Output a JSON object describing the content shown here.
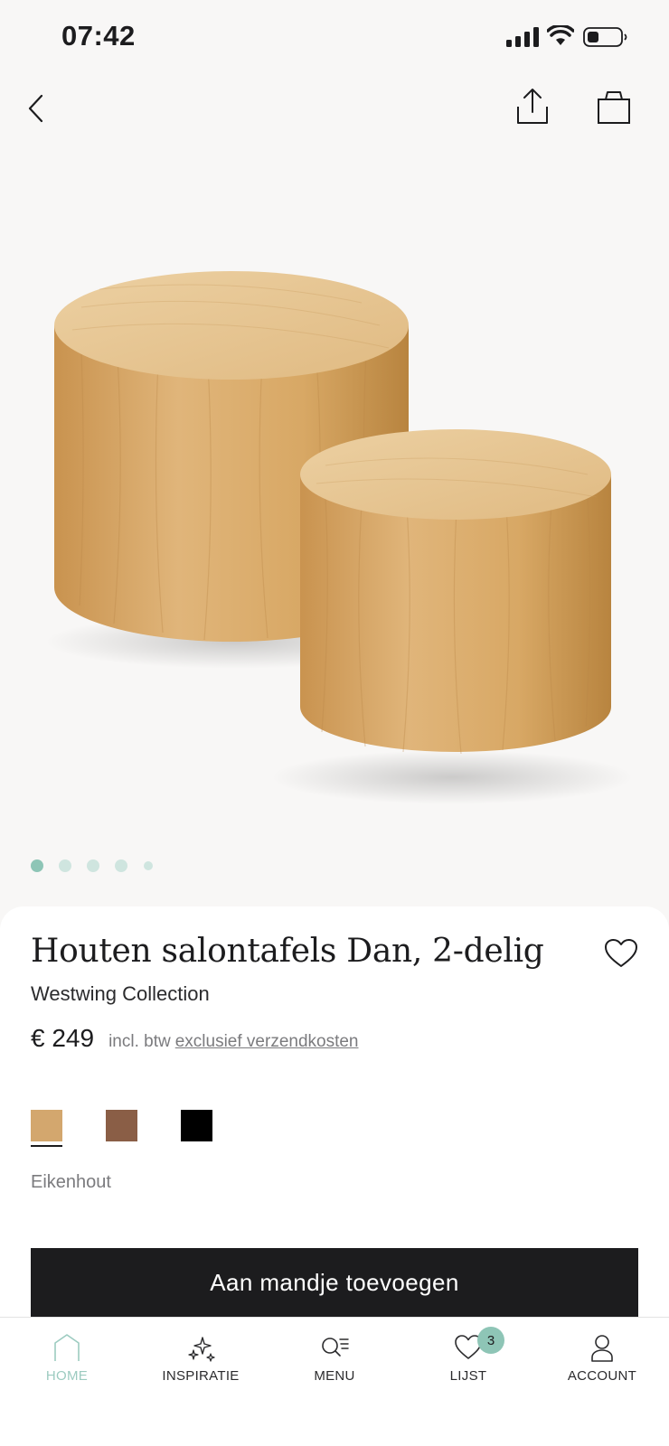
{
  "status_bar": {
    "time": "07:42"
  },
  "product": {
    "title": "Houten salontafels Dan, 2-delig",
    "brand": "Westwing Collection",
    "price": "€ 249",
    "vat_note": "incl. btw",
    "shipping_note": "exclusief verzendkosten",
    "image_count": 5,
    "selected_image": 1,
    "colors": [
      {
        "name": "Eikenhout",
        "hex": "#d3a76e",
        "selected": true
      },
      {
        "name": "",
        "hex": "#8a5e46",
        "selected": false
      },
      {
        "name": "",
        "hex": "#000000",
        "selected": false
      }
    ],
    "selected_variant": "Eikenhout",
    "add_to_cart_label": "Aan mandje toevoegen"
  },
  "bottom_nav": {
    "tabs": [
      {
        "label": "HOME",
        "icon": "home-icon",
        "active": true
      },
      {
        "label": "INSPIRATIE",
        "icon": "sparkle-icon",
        "active": false
      },
      {
        "label": "MENU",
        "icon": "search-menu-icon",
        "active": false
      },
      {
        "label": "LIJST",
        "icon": "heart-icon",
        "active": false,
        "badge": "3"
      },
      {
        "label": "ACCOUNT",
        "icon": "user-icon",
        "active": false
      }
    ]
  },
  "colors": {
    "accent": "#9ccbc0",
    "badge": "#8ec5b6",
    "button": "#1c1c1e"
  }
}
